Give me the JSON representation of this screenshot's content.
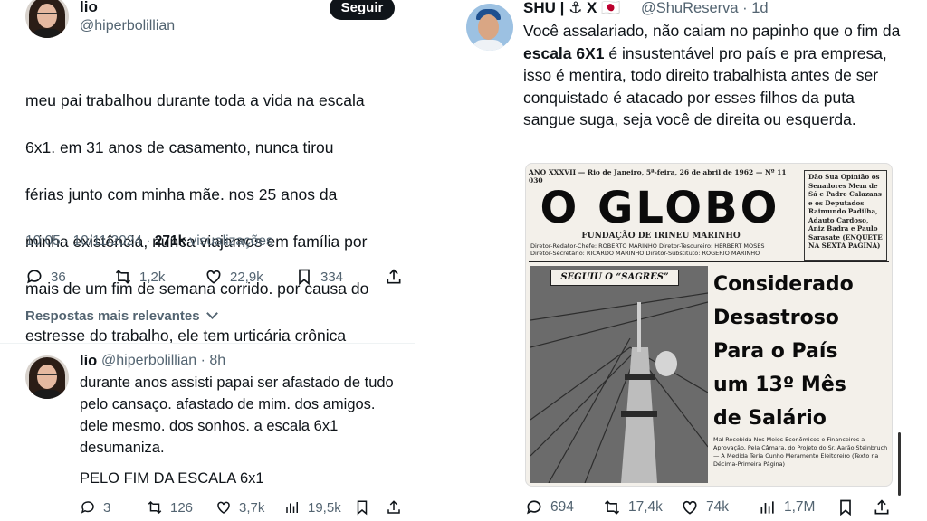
{
  "left_tweet": {
    "name": "lio",
    "handle": "@hiperbolillian",
    "follow_label": "Seguir",
    "text_lines": [
      "meu pai trabalhou durante toda a vida na escala",
      "6x1. em 31 anos de casamento, nunca tirou",
      "férias junto com minha mãe. nos 25 anos da",
      "minha existência, nunca viajamos em família por",
      "mais de um fim de semana corrido. por causa do",
      "estresse do trabalho, ele tem urticária crônica"
    ],
    "timestamp": "10:05 · 10/11/2024 · ",
    "views_count": "271k",
    "views_label": " visualizações",
    "replies": "36",
    "reposts": "1,2k",
    "likes": "22,9k",
    "bookmarks": "334"
  },
  "relevant_label": "Respostas mais relevantes",
  "reply": {
    "name": "lio",
    "handle": "@hiperbolillian · 8h",
    "text": "durante anos assisti papai ser afastado de tudo\npelo cansaço. afastado de mim. dos amigos.\ndele mesmo. dos sonhos. a escala 6x1\ndesumaniza.",
    "text_extra": "PELO FIM DA ESCALA 6x1",
    "replies": "3",
    "reposts": "126",
    "likes": "3,7k",
    "views": "19,5k"
  },
  "right_tweet": {
    "name": "SHU | ⚓ X 🇯🇵",
    "handle": "@ShuReserva · 1d",
    "text_before": "Você assalariado, não caiam no papinho que o fim da ",
    "text_bold": "escala 6X1",
    "text_after": " é insustentável pro país e pra empresa,  isso é mentira, todo direito trabalhista antes de ser conquistado é atacado por esses filhos da puta sangue suga,  seja você de direita ou esquerda.",
    "replies": "694",
    "reposts": "17,4k",
    "likes": "74k",
    "views": "1,7M"
  },
  "newspaper": {
    "dateline": "ANO XXXVII — Rio de Janeiro, 5ª-feira, 26 de abril de 1962 — Nº 11 030",
    "title": "O GLOBO",
    "foundation": "FUNDAÇÃO DE IRINEU MARINHO",
    "staff_1": "Diretor-Redator-Chefe: ROBERTO MARINHO      Diretor-Tesoureiro: HERBERT MOSES",
    "staff_2": "Diretor-Secretário: RICARDO MARINHO          Diretor-Substituto: ROGERIO MARINHO",
    "sidebar": "Dão Sua Opinião os\nSenadores Mem de\nSá e Padre Calazans\ne os Deputados\nRaimundo Padilha,\nAdauto Cardoso,\nAniz Badra e Paulo\nSarasate (ENQUETE\nNA SEXTA PÁGINA)",
    "photo_label": "SEGUIU O “SAGRES”",
    "headline": "Considerado\nDesastroso\nPara o País\num 13º Mês\nde Salário",
    "body": "Mal Recebida Nos Meios Econômicos e Financeiros a Aprovação, Pela Câmara, do Projeto do Sr. Aarão Steinbruch — A Medida Teria Cunho Meramente Eleitoreiro (Texto na Décima-Primeira Página)"
  }
}
